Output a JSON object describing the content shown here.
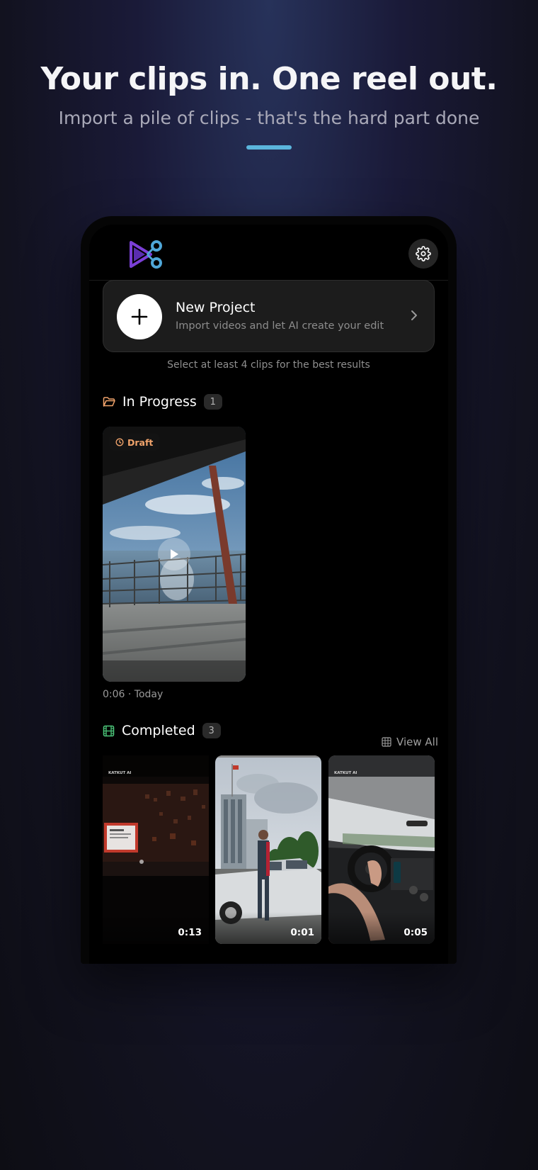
{
  "headline": "Your clips in. One reel out.",
  "subheadline": "Import a pile of clips - that's the hard part done",
  "colors": {
    "accent": "#5bb5dc",
    "logo_purple": "#7b3fd6",
    "logo_blue": "#4fa7d8",
    "draft_orange": "#f0a36b",
    "completed_green": "#4cc77a"
  },
  "app": {
    "logo_icon": "scissors-play-logo",
    "settings_icon": "gear-icon",
    "new_project": {
      "title": "New Project",
      "subtitle": "Import videos and let AI create your edit",
      "icon": "plus-icon",
      "chevron_icon": "chevron-right-icon"
    },
    "hint": "Select at least 4 clips for the best results",
    "in_progress": {
      "title": "In Progress",
      "count": "1",
      "icon": "folder-icon",
      "items": [
        {
          "badge": "Draft",
          "badge_icon": "clock-icon",
          "meta": "0:06 · Today"
        }
      ]
    },
    "completed": {
      "title": "Completed",
      "count": "3",
      "icon": "film-icon",
      "view_all": "View All",
      "view_all_icon": "grid-icon",
      "items": [
        {
          "duration": "0:13",
          "watermark": "KATKUT AI"
        },
        {
          "duration": "0:01"
        },
        {
          "duration": "0:05",
          "watermark": "KATKUT AI"
        }
      ]
    }
  }
}
